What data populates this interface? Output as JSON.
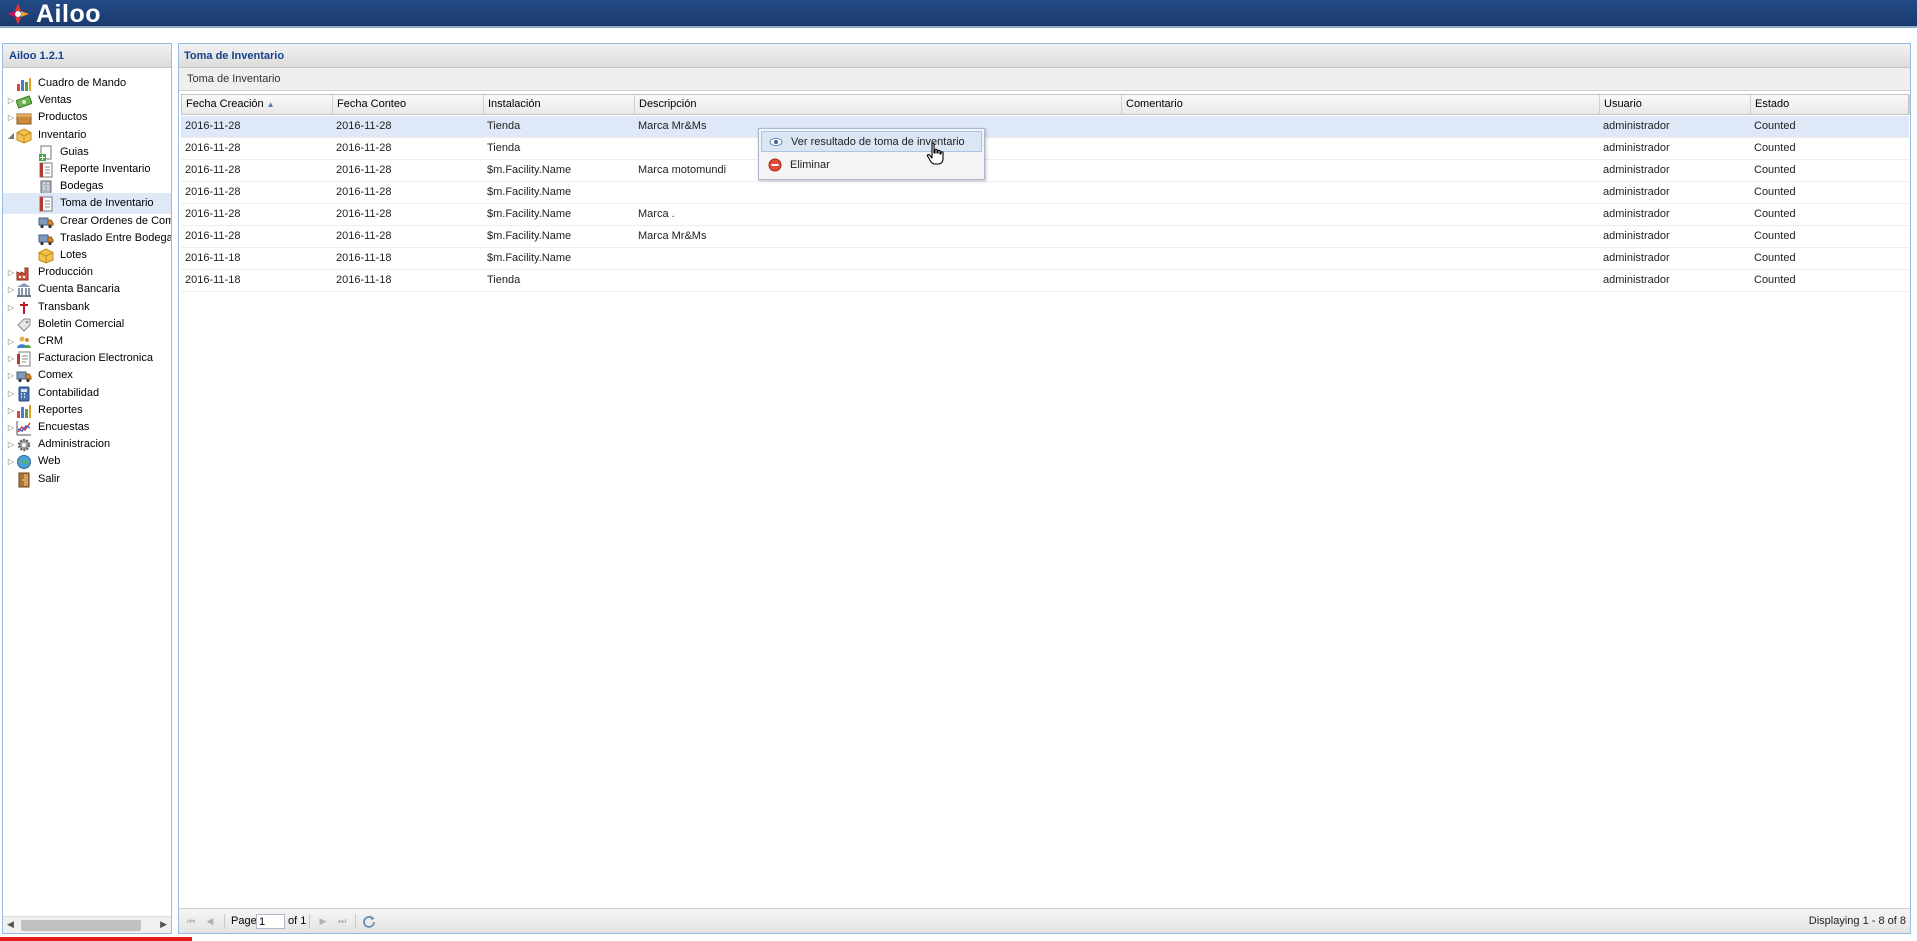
{
  "app": {
    "name": "Ailoo",
    "brand_color": "#1d4079",
    "accent_color": "#15428b"
  },
  "sidebar": {
    "title": "Ailoo 1.2.1",
    "items": [
      {
        "label": "Cuadro de Mando",
        "icon": "bar-chart-icon",
        "level": 0,
        "expandable": false
      },
      {
        "label": "Ventas",
        "icon": "money-icon",
        "level": 0,
        "expandable": true,
        "state": "collapsed"
      },
      {
        "label": "Productos",
        "icon": "box-icon",
        "level": 0,
        "expandable": true,
        "state": "collapsed"
      },
      {
        "label": "Inventario",
        "icon": "package-icon",
        "level": 0,
        "expandable": true,
        "state": "expanded"
      },
      {
        "label": "Guias",
        "icon": "document-add-icon",
        "level": 1,
        "expandable": false
      },
      {
        "label": "Reporte Inventario",
        "icon": "report-icon",
        "level": 1,
        "expandable": false
      },
      {
        "label": "Bodegas",
        "icon": "building-icon",
        "level": 1,
        "expandable": false
      },
      {
        "label": "Toma de Inventario",
        "icon": "report-icon",
        "level": 1,
        "expandable": false,
        "selected": true
      },
      {
        "label": "Crear Ordenes de Com",
        "icon": "truck-icon",
        "level": 1,
        "expandable": false
      },
      {
        "label": "Traslado Entre Bodegas",
        "icon": "truck-icon",
        "level": 1,
        "expandable": false
      },
      {
        "label": "Lotes",
        "icon": "package-icon",
        "level": 1,
        "expandable": false
      },
      {
        "label": "Producción",
        "icon": "factory-icon",
        "level": 0,
        "expandable": true,
        "state": "collapsed"
      },
      {
        "label": "Cuenta Bancaria",
        "icon": "bank-icon",
        "level": 0,
        "expandable": true,
        "state": "collapsed"
      },
      {
        "label": "Transbank",
        "icon": "transbank-icon",
        "level": 0,
        "expandable": true,
        "state": "collapsed"
      },
      {
        "label": "Boletin Comercial",
        "icon": "tag-icon",
        "level": 0,
        "expandable": false
      },
      {
        "label": "CRM",
        "icon": "users-icon",
        "level": 0,
        "expandable": true,
        "state": "collapsed"
      },
      {
        "label": "Facturacion Electronica",
        "icon": "invoice-icon",
        "level": 0,
        "expandable": true,
        "state": "collapsed"
      },
      {
        "label": "Comex",
        "icon": "truck-icon",
        "level": 0,
        "expandable": true,
        "state": "collapsed"
      },
      {
        "label": "Contabilidad",
        "icon": "calculator-icon",
        "level": 0,
        "expandable": true,
        "state": "collapsed"
      },
      {
        "label": "Reportes",
        "icon": "bar-chart-icon",
        "level": 0,
        "expandable": true,
        "state": "collapsed"
      },
      {
        "label": "Encuestas",
        "icon": "line-chart-icon",
        "level": 0,
        "expandable": true,
        "state": "collapsed"
      },
      {
        "label": "Administracion",
        "icon": "gear-icon",
        "level": 0,
        "expandable": true,
        "state": "collapsed"
      },
      {
        "label": "Web",
        "icon": "globe-icon",
        "level": 0,
        "expandable": true,
        "state": "collapsed"
      },
      {
        "label": "Salir",
        "icon": "door-icon",
        "level": 0,
        "expandable": false
      }
    ]
  },
  "main": {
    "title": "Toma de Inventario",
    "inner_title": "Toma de Inventario",
    "columns": [
      "Fecha Creación",
      "Fecha Conteo",
      "Instalación",
      "Descripción",
      "Comentario",
      "Usuario",
      "Estado"
    ],
    "sort_column": "Fecha Creación",
    "rows": [
      [
        "2016-11-28",
        "2016-11-28",
        "Tienda",
        "Marca Mr&Ms",
        "",
        "administrador",
        "Counted"
      ],
      [
        "2016-11-28",
        "2016-11-28",
        "Tienda",
        "",
        "",
        "administrador",
        "Counted"
      ],
      [
        "2016-11-28",
        "2016-11-28",
        "$m.Facility.Name",
        "Marca motomundi",
        "",
        "administrador",
        "Counted"
      ],
      [
        "2016-11-28",
        "2016-11-28",
        "$m.Facility.Name",
        "",
        "",
        "administrador",
        "Counted"
      ],
      [
        "2016-11-28",
        "2016-11-28",
        "$m.Facility.Name",
        "Marca .",
        "",
        "administrador",
        "Counted"
      ],
      [
        "2016-11-28",
        "2016-11-28",
        "$m.Facility.Name",
        "Marca Mr&Ms",
        "",
        "administrador",
        "Counted"
      ],
      [
        "2016-11-18",
        "2016-11-18",
        "$m.Facility.Name",
        "",
        "",
        "administrador",
        "Counted"
      ],
      [
        "2016-11-18",
        "2016-11-18",
        "Tienda",
        "",
        "",
        "administrador",
        "Counted"
      ]
    ],
    "highlighted_row": 0
  },
  "context_menu": {
    "items": [
      {
        "label": "Ver resultado de toma de inventario",
        "icon": "eye-icon",
        "active": true
      },
      {
        "label": "Eliminar",
        "icon": "delete-icon",
        "active": false
      }
    ]
  },
  "pager": {
    "page_label": "Page",
    "page_value": "1",
    "of_label": "of 1",
    "displaying": "Displaying 1 - 8 of 8"
  }
}
